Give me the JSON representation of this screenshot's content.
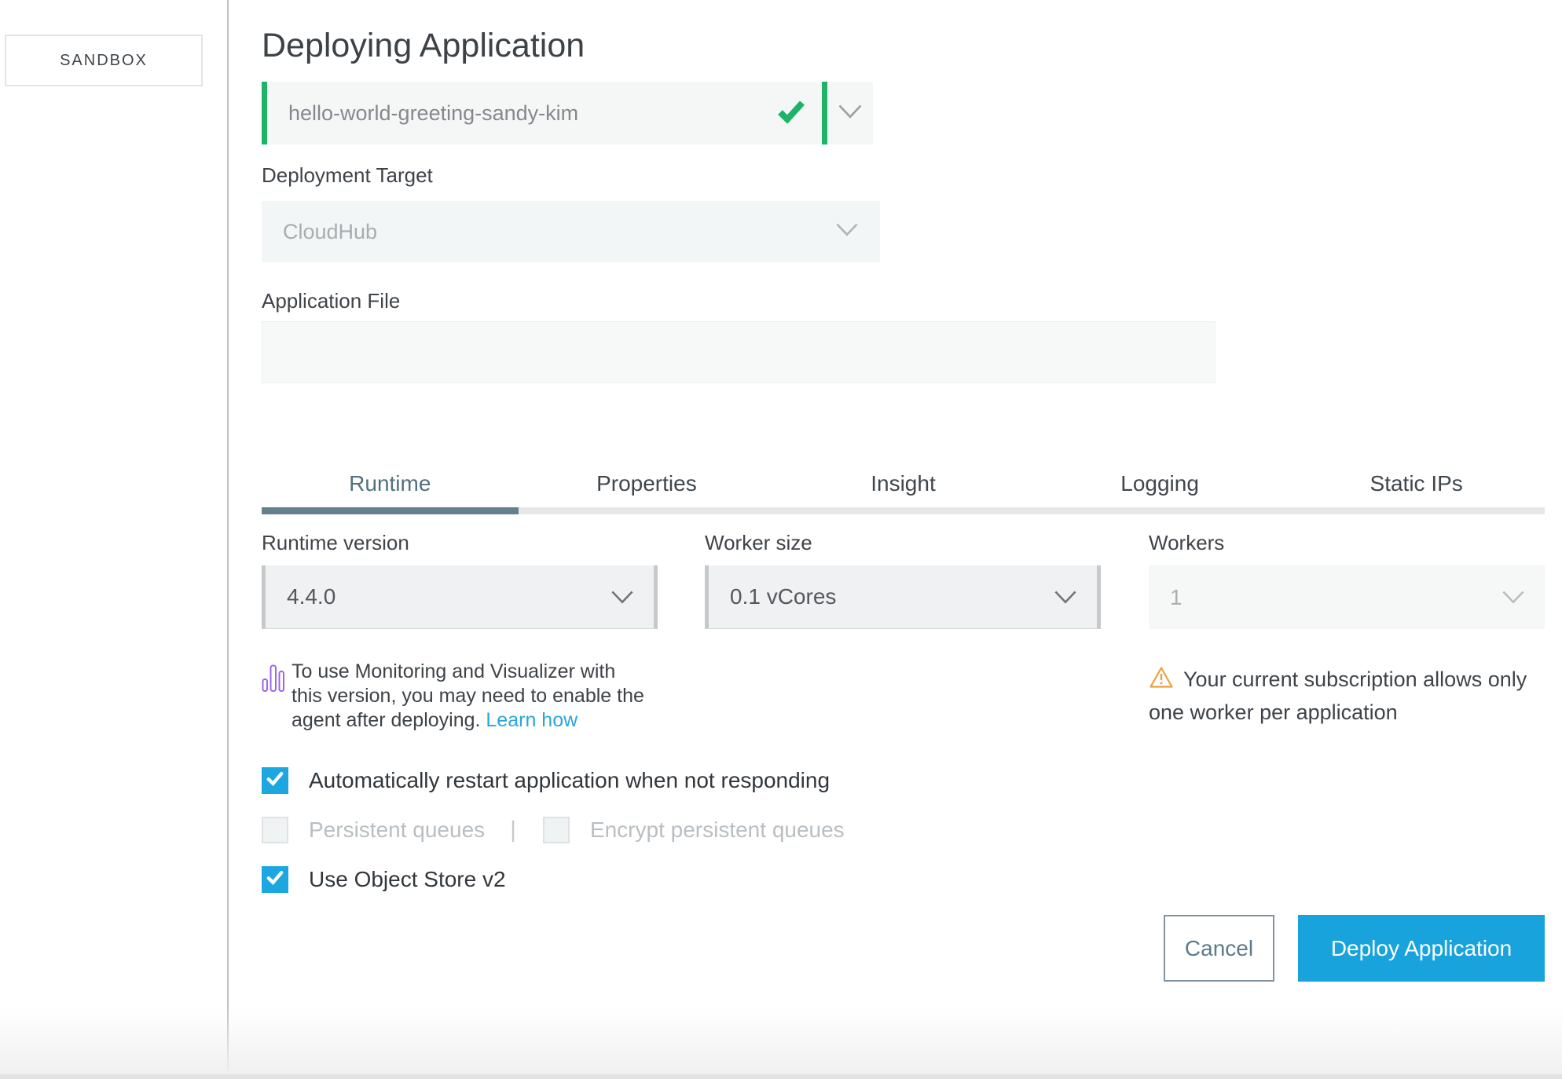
{
  "sidebar": {
    "environment_label": "SANDBOX"
  },
  "header": {
    "title": "Deploying Application"
  },
  "app_name": {
    "value": "hello-world-greeting-sandy-kim"
  },
  "deployment_target": {
    "label": "Deployment Target",
    "value": "CloudHub"
  },
  "application_file": {
    "label": "Application File",
    "value": ""
  },
  "tabs": [
    {
      "label": "Runtime",
      "active": true
    },
    {
      "label": "Properties",
      "active": false
    },
    {
      "label": "Insight",
      "active": false
    },
    {
      "label": "Logging",
      "active": false
    },
    {
      "label": "Static IPs",
      "active": false
    }
  ],
  "runtime": {
    "runtime_version": {
      "label": "Runtime version",
      "value": "4.4.0"
    },
    "worker_size": {
      "label": "Worker size",
      "value": "0.1 vCores"
    },
    "workers": {
      "label": "Workers",
      "value": "1"
    },
    "monitoring_note": {
      "text": "To use Monitoring and Visualizer with this version, you may need to enable the agent after deploying. ",
      "link_label": "Learn how"
    },
    "worker_warning": "Your current subscription allows only one worker per application",
    "checkboxes": [
      {
        "label": "Automatically restart application when not responding",
        "checked": true,
        "disabled": false
      },
      {
        "label": "Persistent queues",
        "checked": false,
        "disabled": true
      },
      {
        "label": "Encrypt persistent queues",
        "checked": false,
        "disabled": true
      },
      {
        "label": "Use Object Store v2",
        "checked": true,
        "disabled": false
      }
    ]
  },
  "footer": {
    "cancel_label": "Cancel",
    "deploy_label": "Deploy Application"
  },
  "icons": {
    "app_name_valid": "check-icon",
    "dropdowns": "chevron-down-icon",
    "monitoring": "bar-chart-icon",
    "warning": "warning-triangle-icon",
    "checkbox": "checkmark-icon"
  },
  "colors": {
    "green": "#1eb468",
    "deploy_blue": "#18a3dc",
    "checkbox_blue": "#1da7e0",
    "link_blue": "#2aa5dc",
    "warning_amber": "#e8a33b",
    "monitoring_purple": "#9a67e6",
    "tab_active": "#53707f",
    "tab_bar_active": "#64808e"
  }
}
